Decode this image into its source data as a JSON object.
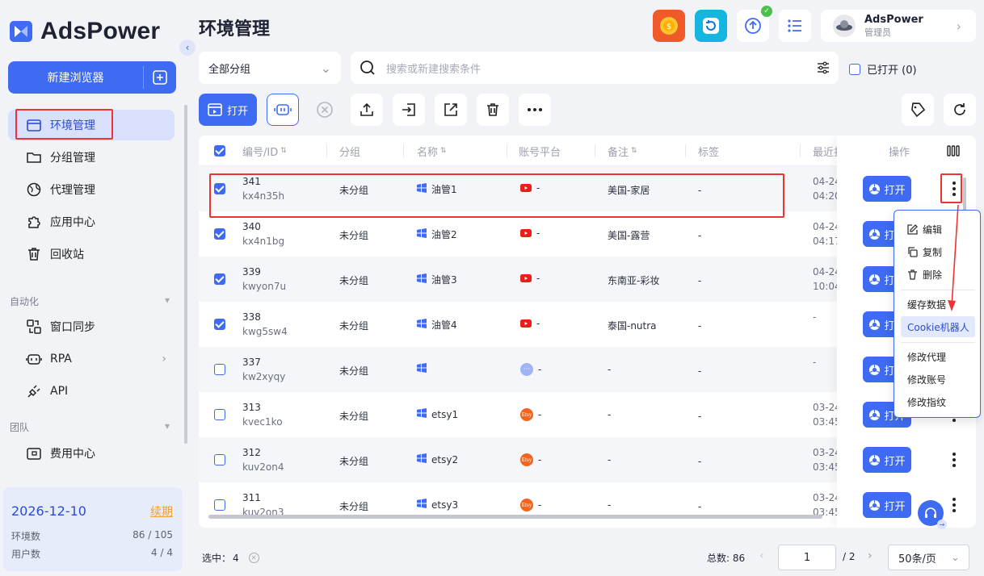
{
  "app": {
    "name": "AdsPower",
    "page_title": "环境管理"
  },
  "sidebar": {
    "new_browser_label": "新建浏览器",
    "items": [
      {
        "label": "环境管理",
        "icon": "window-icon",
        "active": true
      },
      {
        "label": "分组管理",
        "icon": "folder-icon"
      },
      {
        "label": "代理管理",
        "icon": "globe-icon"
      },
      {
        "label": "应用中心",
        "icon": "puzzle-icon"
      },
      {
        "label": "回收站",
        "icon": "trash-icon"
      }
    ],
    "section_automation": "自动化",
    "automation_items": [
      {
        "label": "窗口同步",
        "icon": "sync-icon"
      },
      {
        "label": "RPA",
        "icon": "robot-icon"
      },
      {
        "label": "API",
        "icon": "plug-icon"
      }
    ],
    "section_team": "团队",
    "team_items": [
      {
        "label": "费用中心",
        "icon": "wallet-icon"
      }
    ],
    "info": {
      "date": "2026-12-10",
      "renew_label": "续期",
      "env_label": "环境数",
      "env_value": "86 / 105",
      "user_label": "用户数",
      "user_value": "4 / 4"
    }
  },
  "header": {
    "user_name": "AdsPower",
    "user_role": "管理员"
  },
  "filters": {
    "group_select": "全部分组",
    "search_placeholder": "搜索或新建搜索条件",
    "opened_label": "已打开 (0)"
  },
  "toolbar": {
    "open_label": "打开"
  },
  "table": {
    "headers": {
      "id": "编号/ID",
      "group": "分组",
      "name": "名称",
      "platform": "账号平台",
      "note": "备注",
      "tag": "标签",
      "last_open": "最近打",
      "actions": "操作"
    },
    "rows": [
      {
        "num": "341",
        "id": "kx4n35h",
        "group": "未分组",
        "name": "油管1",
        "platform": "youtube",
        "account": "-",
        "note": "美国-家居",
        "tag": "-",
        "last1": "04-24",
        "last2": "04:20",
        "checked": true
      },
      {
        "num": "340",
        "id": "kx4n1bg",
        "group": "未分组",
        "name": "油管2",
        "platform": "youtube",
        "account": "-",
        "note": "美国-露营",
        "tag": "-",
        "last1": "04-24",
        "last2": "04:17",
        "checked": true
      },
      {
        "num": "339",
        "id": "kwyon7u",
        "group": "未分组",
        "name": "油管3",
        "platform": "youtube",
        "account": "-",
        "note": "东南亚-彩妆",
        "tag": "-",
        "last1": "04-24",
        "last2": "10:04",
        "checked": true
      },
      {
        "num": "338",
        "id": "kwg5sw4",
        "group": "未分组",
        "name": "油管4",
        "platform": "youtube",
        "account": "-",
        "note": "泰国-nutra",
        "tag": "-",
        "last1": "-",
        "last2": "",
        "checked": true
      },
      {
        "num": "337",
        "id": "kw2xyqy",
        "group": "未分组",
        "name": "",
        "platform": "other",
        "account": "-",
        "note": "-",
        "tag": "-",
        "last1": "-",
        "last2": "",
        "checked": false
      },
      {
        "num": "313",
        "id": "kvec1ko",
        "group": "未分组",
        "name": "etsy1",
        "platform": "etsy",
        "account": "-",
        "note": "-",
        "tag": "-",
        "last1": "03-24",
        "last2": "03:45",
        "checked": false
      },
      {
        "num": "312",
        "id": "kuv2on4",
        "group": "未分组",
        "name": "etsy2",
        "platform": "etsy",
        "account": "-",
        "note": "-",
        "tag": "-",
        "last1": "03-24",
        "last2": "03:45",
        "checked": false
      },
      {
        "num": "311",
        "id": "kuv2on3",
        "group": "未分组",
        "name": "etsy3",
        "platform": "etsy",
        "account": "-",
        "note": "-",
        "tag": "-",
        "last1": "03-24",
        "last2": "03:45",
        "checked": false
      }
    ],
    "open_btn_label": "打开",
    "etsy_text": "Etsy"
  },
  "context_menu": {
    "items": [
      "编辑",
      "复制",
      "删除",
      "缓存数据",
      "Cookie机器人",
      "修改代理",
      "修改账号",
      "修改指纹"
    ],
    "highlighted": "Cookie机器人"
  },
  "footer": {
    "selected_label": "选中：",
    "selected_count": "4",
    "total_label": "总数: 86",
    "current_page": "1",
    "page_total": "/ 2",
    "page_size": "50条/页"
  },
  "colors": {
    "accent": "#3f6bf2",
    "highlight_red": "#e33333",
    "youtube": "#e62117",
    "etsy": "#f1641e"
  }
}
